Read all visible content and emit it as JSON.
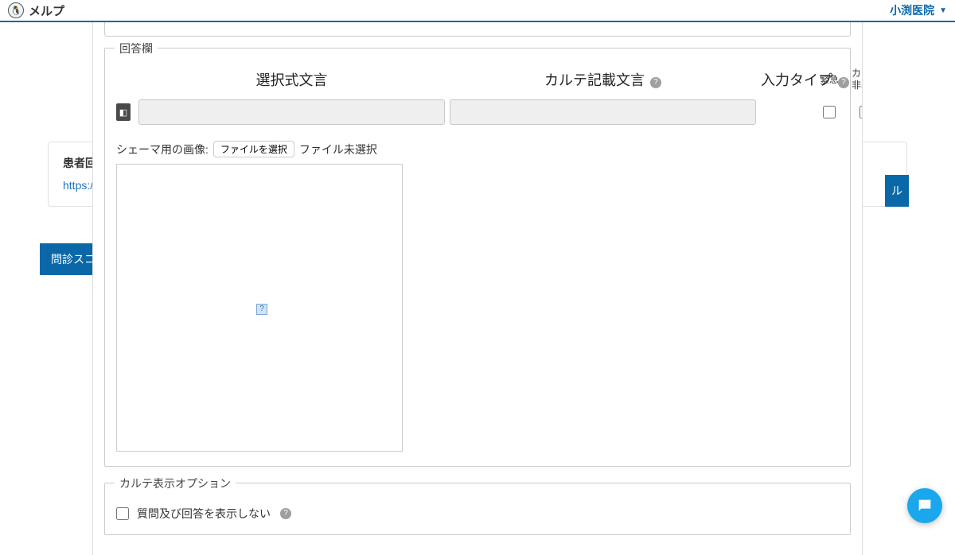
{
  "topbar": {
    "brand": "メルプ",
    "clinic": "小渕医院"
  },
  "background": {
    "label1": "患者回答",
    "url_fragment": "https://",
    "score_button": "問診スコア",
    "right_partial": "ル"
  },
  "answer_fieldset": {
    "legend": "回答欄",
    "col_choice": "選択式文言",
    "col_record": "カルテ記載文言",
    "col_input_type": "入力タイプ",
    "col_urgent": "緊急",
    "col_hide": "カルテ非表示",
    "schema_label": "シェーマ用の画像:",
    "file_button": "ファイルを選択",
    "file_status": "ファイル未選択"
  },
  "display_options": {
    "legend": "カルテ表示オプション",
    "opt_hide_qa": "質問及び回答を表示しない"
  }
}
